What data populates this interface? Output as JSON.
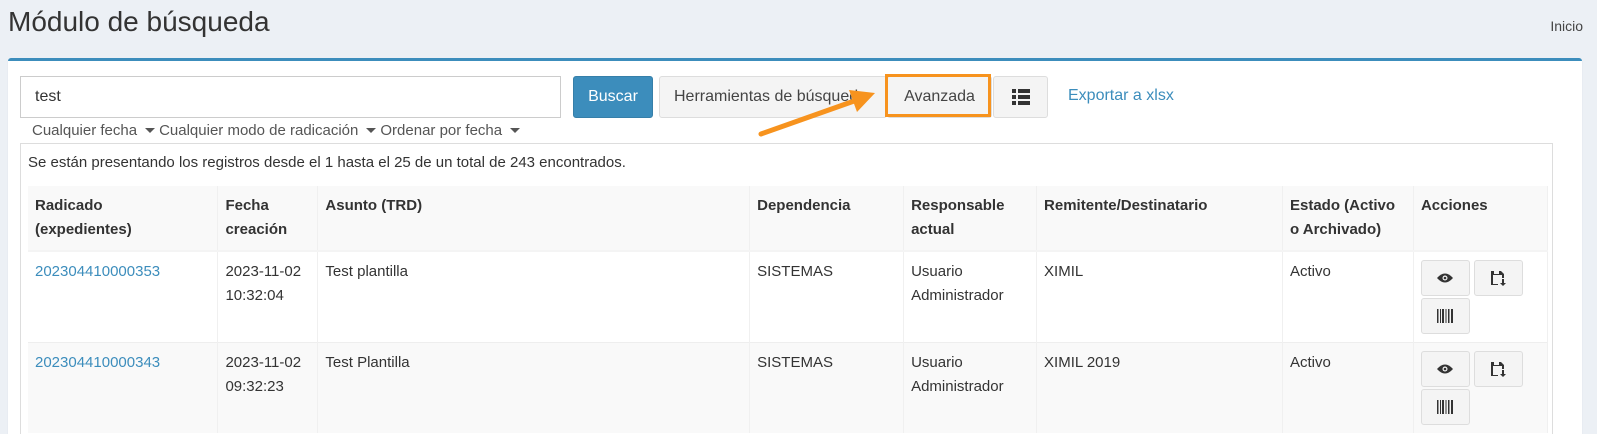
{
  "header": {
    "title": "Módulo de búsqueda",
    "breadcrumb": "Inicio"
  },
  "search": {
    "value": "test",
    "buscar_label": "Buscar",
    "tools_label": "Herramientas de búsqueda",
    "advanced_label": "Avanzada",
    "export_label": "Exportar a xlsx"
  },
  "filters": {
    "date": "Cualquier fecha",
    "mode": "Cualquier modo de radicación",
    "order": "Ordenar por fecha"
  },
  "results": {
    "summary": "Se están presentando los registros desde el 1 hasta el 25 de un total de 243 encontrados.",
    "columns": [
      [
        "Radicado",
        "(expedientes)"
      ],
      [
        "Fecha",
        "creación"
      ],
      [
        "Asunto (TRD)"
      ],
      [
        "Dependencia"
      ],
      [
        "Responsable",
        "actual"
      ],
      [
        "Remitente/Destinatario"
      ],
      [
        "Estado (Activo",
        "o Archivado)"
      ],
      [
        "Acciones"
      ]
    ],
    "rows": [
      {
        "radicado": "202304410000353",
        "fecha": "2023-11-02",
        "hora": "10:32:04",
        "asunto": "Test plantilla",
        "dependencia": "SISTEMAS",
        "responsable1": "Usuario",
        "responsable2": "Administrador",
        "remitente": "XIMIL",
        "estado": "Activo"
      },
      {
        "radicado": "202304410000343",
        "fecha": "2023-11-02",
        "hora": "09:32:23",
        "asunto": "Test Plantilla",
        "dependencia": "SISTEMAS",
        "responsable1": "Usuario",
        "responsable2": "Administrador",
        "remitente": "XIMIL 2019",
        "estado": "Activo"
      }
    ]
  },
  "colors": {
    "primary": "#3c8dbc",
    "highlight": "#f7931e"
  },
  "icons": [
    "list-icon",
    "eye-icon",
    "save-icon",
    "barcode-icon",
    "caret-down-icon",
    "arrow-annotation"
  ]
}
